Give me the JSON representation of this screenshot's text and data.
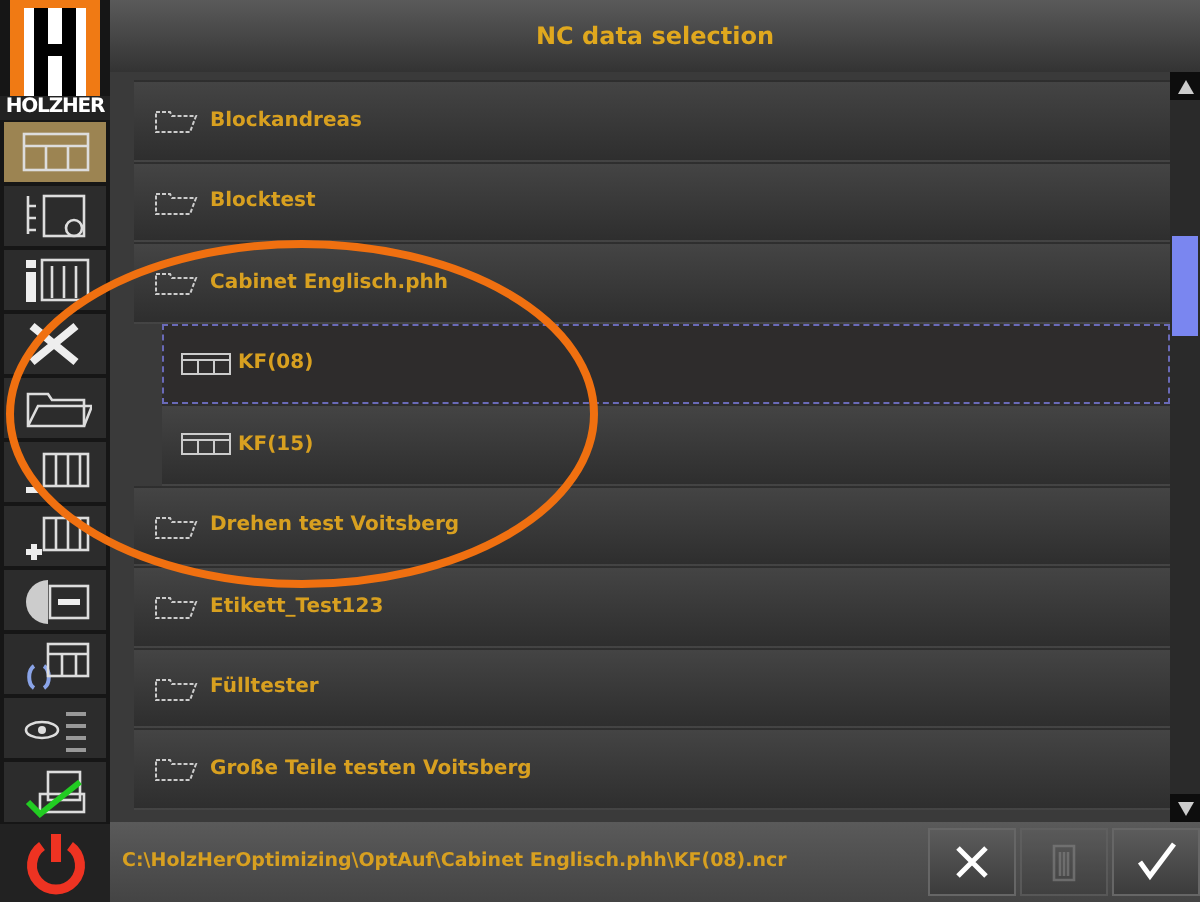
{
  "logo": {
    "text": "HOLZHER"
  },
  "sidebar": {
    "items": [
      {
        "kind": "grid",
        "selected": true
      },
      {
        "kind": "tree",
        "selected": false
      },
      {
        "kind": "info",
        "selected": false
      },
      {
        "kind": "tools",
        "selected": false
      },
      {
        "kind": "folder",
        "selected": false
      },
      {
        "kind": "remove",
        "selected": false
      },
      {
        "kind": "add",
        "selected": false
      },
      {
        "kind": "half",
        "selected": false
      },
      {
        "kind": "bracket",
        "selected": false
      },
      {
        "kind": "view",
        "selected": false
      },
      {
        "kind": "print",
        "selected": false
      }
    ]
  },
  "window": {
    "title": "NC data selection"
  },
  "tree": [
    {
      "label": "Blockandreas",
      "kind": "folder",
      "selected": false
    },
    {
      "label": "Blocktest",
      "kind": "folder",
      "selected": false
    },
    {
      "label": "Cabinet Englisch.phh",
      "kind": "folder",
      "selected": false,
      "children": [
        {
          "label": "KF(08)",
          "kind": "file",
          "selected": true
        },
        {
          "label": "KF(15)",
          "kind": "file",
          "selected": false
        }
      ]
    },
    {
      "label": "Drehen test Voitsberg",
      "kind": "folder",
      "selected": false
    },
    {
      "label": "Etikett_Test123",
      "kind": "folder",
      "selected": false
    },
    {
      "label": "Fülltester",
      "kind": "folder",
      "selected": false
    },
    {
      "label": "Große Teile testen Voitsberg",
      "kind": "folder",
      "selected": false
    }
  ],
  "status_bar": {
    "path": "C:\\HolzHerOptimizing\\OptAuf\\Cabinet Englisch.phh\\KF(08).ncr"
  },
  "buttons": [
    {
      "kind": "cancel",
      "disabled": false
    },
    {
      "kind": "delete",
      "disabled": true
    },
    {
      "kind": "ok",
      "disabled": false
    }
  ],
  "annotation": {
    "kind": "ellipse"
  }
}
